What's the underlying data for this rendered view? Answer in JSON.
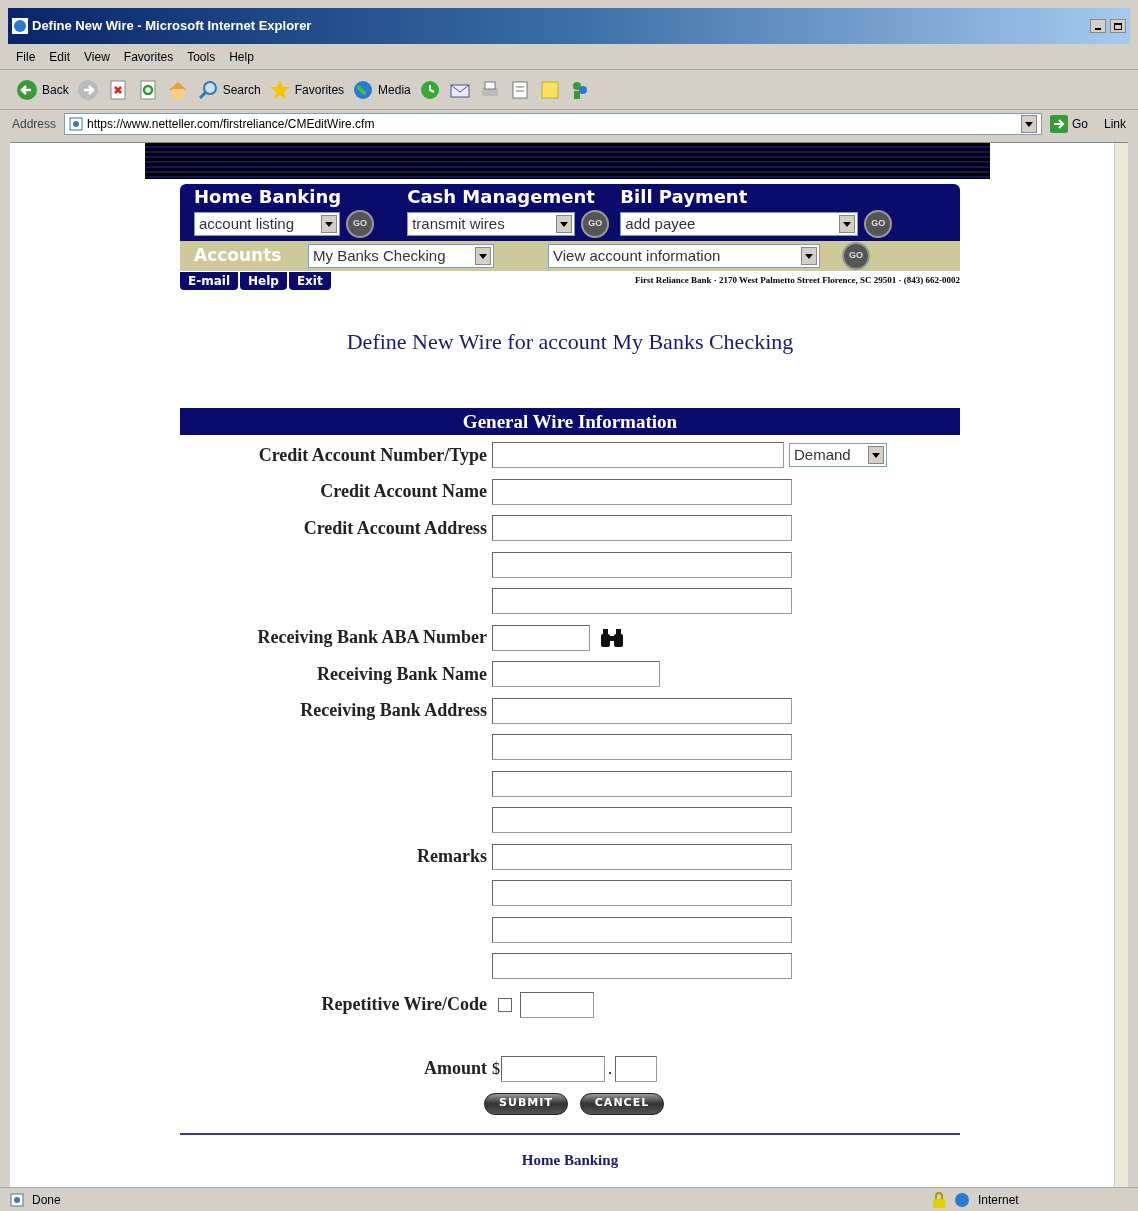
{
  "window": {
    "title": "Define New Wire - Microsoft Internet Explorer"
  },
  "menu": [
    "File",
    "Edit",
    "View",
    "Favorites",
    "Tools",
    "Help"
  ],
  "toolbar": [
    {
      "kind": "back",
      "label": "Back"
    },
    {
      "kind": "forward"
    },
    {
      "kind": "stop"
    },
    {
      "kind": "refresh"
    },
    {
      "kind": "home"
    },
    {
      "kind": "search",
      "label": "Search"
    },
    {
      "kind": "favorites",
      "label": "Favorites"
    },
    {
      "kind": "media",
      "label": "Media"
    },
    {
      "kind": "history"
    },
    {
      "kind": "mail"
    },
    {
      "kind": "print"
    },
    {
      "kind": "edit"
    },
    {
      "kind": "folder"
    },
    {
      "kind": "messenger"
    }
  ],
  "address_bar": {
    "label": "Address",
    "url": "https://www.netteller.com/firstreliance/CMEditWire.cfm",
    "go": "Go",
    "links": "Link"
  },
  "nav": {
    "sections": [
      {
        "title": "Home Banking",
        "value": "account listing",
        "go": "GO"
      },
      {
        "title": "Cash Management",
        "value": "transmit wires",
        "go": "GO"
      },
      {
        "title": "Bill Payment",
        "value": "add payee",
        "go": "GO"
      }
    ],
    "accounts": {
      "label": "Accounts",
      "account": "My Banks Checking",
      "action": "View account information",
      "go": "GO"
    },
    "links": [
      "E-mail",
      "Help",
      "Exit"
    ],
    "bank_info": "First Reliance Bank · 2170 West Palmetto Street Florence, SC 29501 · (843) 662-0002"
  },
  "heading": "Define New Wire for account My Banks Checking",
  "section_title": "General Wire Information",
  "rows": [
    {
      "kind": "account_type",
      "label": "Credit Account Number/Type",
      "type": "Demand"
    },
    {
      "kind": "text",
      "label": "Credit Account Name"
    },
    {
      "kind": "text",
      "label": "Credit Account Address"
    },
    {
      "kind": "text"
    },
    {
      "kind": "text"
    },
    {
      "kind": "lookup",
      "label": "Receiving Bank ABA Number"
    },
    {
      "kind": "medium",
      "label": "Receiving Bank Name"
    },
    {
      "kind": "text",
      "label": "Receiving Bank Address"
    },
    {
      "kind": "text"
    },
    {
      "kind": "text"
    },
    {
      "kind": "text"
    },
    {
      "kind": "text",
      "label": "Remarks"
    },
    {
      "kind": "text"
    },
    {
      "kind": "text"
    },
    {
      "kind": "text"
    },
    {
      "kind": "checkbox_code",
      "label": "Repetitive Wire/Code",
      "checked": false
    },
    {
      "kind": "amount",
      "label": "Amount",
      "currency": "$",
      "separator": "."
    }
  ],
  "buttons": [
    "SUBMIT",
    "CANCEL"
  ],
  "footer_link": "Home Banking",
  "status_bar": {
    "text": "Done",
    "zone": "Internet"
  }
}
